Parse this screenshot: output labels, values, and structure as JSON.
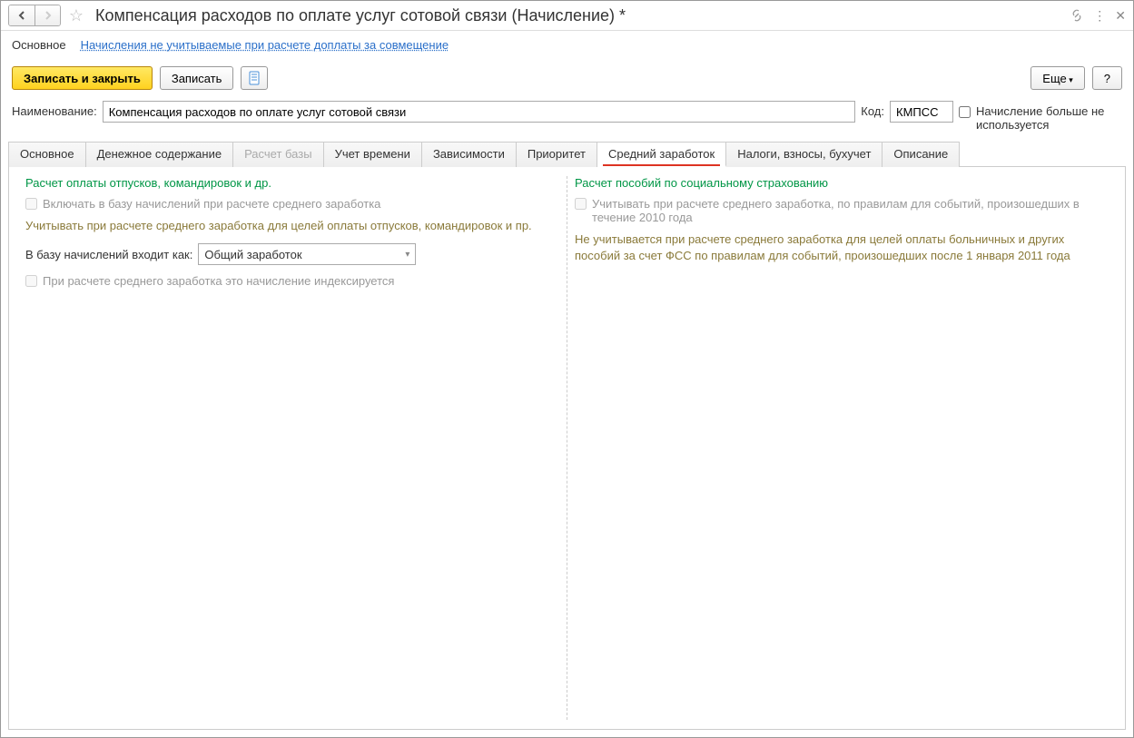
{
  "title": "Компенсация расходов по оплате услуг сотовой связи (Начисление) *",
  "nav": {
    "main": "Основное",
    "link": "Начисления не учитываемые при расчете доплаты за совмещение"
  },
  "toolbar": {
    "save_close": "Записать и закрыть",
    "save": "Записать",
    "more": "Еще",
    "help": "?"
  },
  "form": {
    "name_label": "Наименование:",
    "name_value": "Компенсация расходов по оплате услуг сотовой связи",
    "code_label": "Код:",
    "code_value": "КМПСС",
    "not_used": "Начисление больше не используется"
  },
  "tabs": [
    "Основное",
    "Денежное содержание",
    "Расчет базы",
    "Учет времени",
    "Зависимости",
    "Приоритет",
    "Средний заработок",
    "Налоги, взносы, бухучет",
    "Описание"
  ],
  "left": {
    "title": "Расчет оплаты отпусков, командировок и др.",
    "chk_include": "Включать в базу начислений при расчете среднего заработка",
    "hint1": "Учитывать при расчете среднего заработка для целей оплаты отпусков, командировок и пр.",
    "base_label": "В базу начислений входит как:",
    "base_value": "Общий заработок",
    "chk_index": "При расчете среднего заработка это начисление индексируется"
  },
  "right": {
    "title": "Расчет пособий по социальному страхованию",
    "chk_2010": "Учитывать при расчете среднего заработка, по правилам для событий, произошедших в течение 2010 года",
    "hint2": "Не учитывается при расчете среднего заработка для целей оплаты больничных и других пособий за счет ФСС по правилам для событий, произошедших после 1 января 2011 года"
  }
}
